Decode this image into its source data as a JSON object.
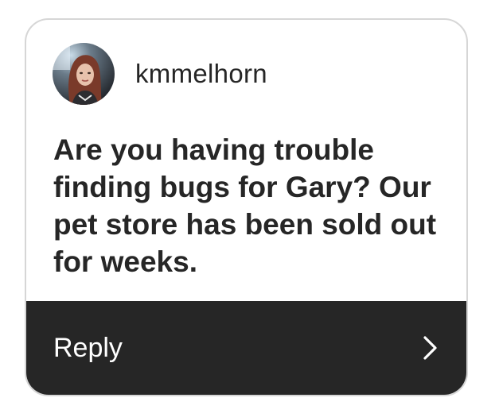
{
  "comment": {
    "username": "kmmelhorn",
    "avatar_icon": "user-avatar",
    "text": "Are you having trouble finding bugs for Gary? Our pet store has been sold out for weeks."
  },
  "reply_bar": {
    "label": "Reply",
    "icon": "chevron-right-icon"
  },
  "colors": {
    "text": "#262626",
    "bar": "#262626",
    "border": "#d6d6d6"
  }
}
